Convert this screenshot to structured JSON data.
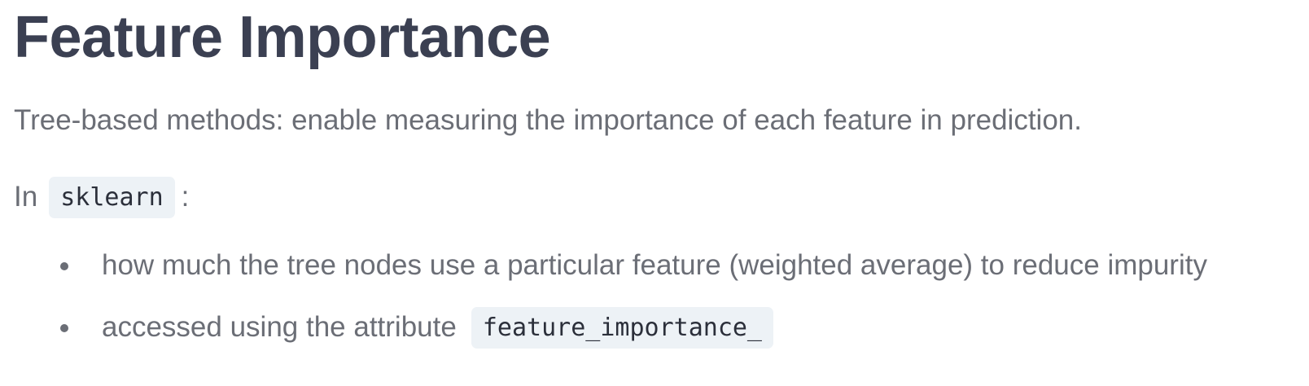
{
  "title": "Feature Importance",
  "lead": "Tree-based methods: enable measuring the importance of each feature in prediction.",
  "intro": {
    "prefix": "In",
    "code": "sklearn",
    "suffix": ":"
  },
  "bullets": [
    {
      "text": "how much the tree nodes use a particular feature (weighted average) to reduce impurity",
      "code": ""
    },
    {
      "text": "accessed using the attribute",
      "code": "feature_importance_"
    }
  ]
}
